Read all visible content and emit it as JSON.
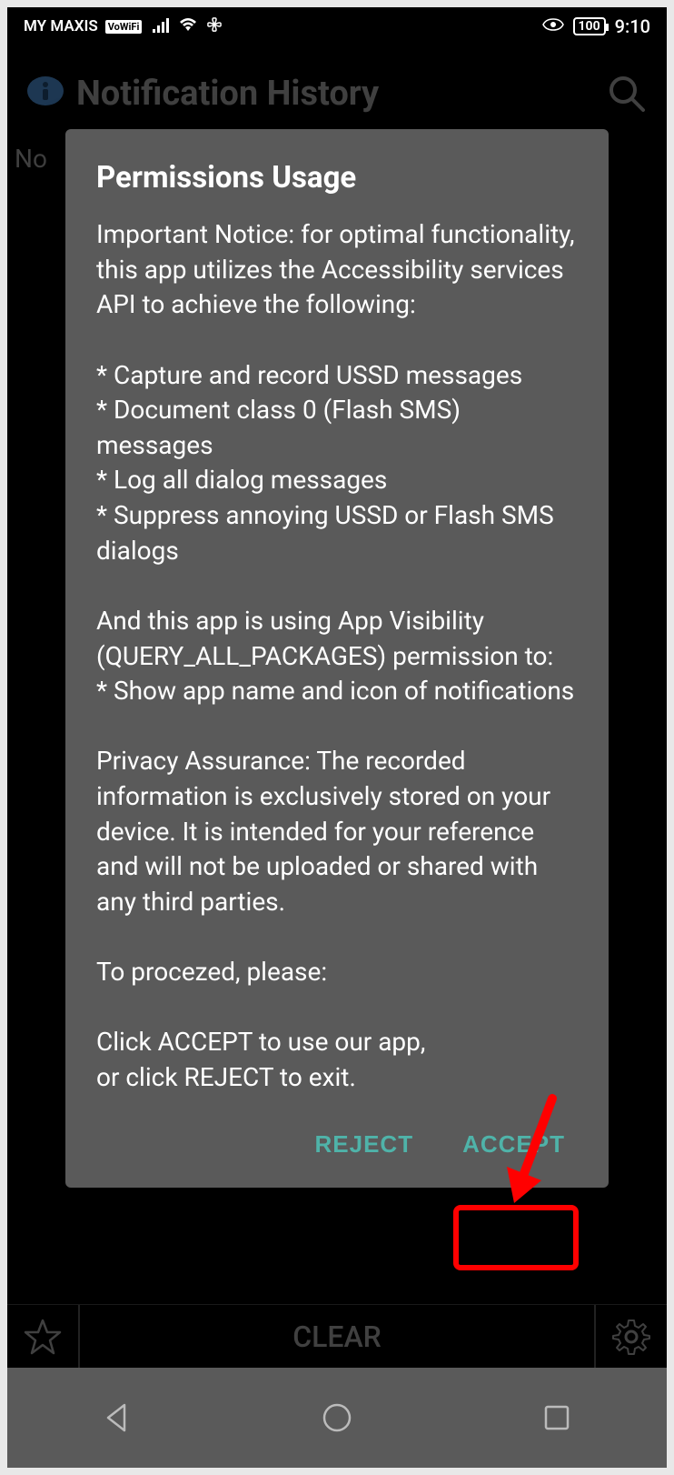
{
  "statusBar": {
    "carrier": "MY MAXIS",
    "vowifi": "VoWiFi",
    "battery": "100",
    "time": "9:10"
  },
  "appHeader": {
    "title": "Notification History"
  },
  "emptyState": "No",
  "toolbar": {
    "clear": "CLEAR"
  },
  "dialog": {
    "title": "Permissions Usage",
    "body": "Important Notice: for optimal functionality, this app utilizes the Accessibility services API to achieve the following:\n\n* Capture and record USSD messages\n* Document class 0 (Flash SMS) messages\n* Log all dialog messages\n* Suppress annoying USSD or Flash SMS dialogs\n\nAnd this app is using App Visibility (QUERY_ALL_PACKAGES) permission to:\n* Show app name and icon of notifications\n\nPrivacy Assurance: The recorded information is exclusively stored on your device. It is intended for your reference and will not be uploaded or shared with any third parties.\n\nTo procezed, please:\n\nClick ACCEPT to use our app,\nor click REJECT to exit.",
    "reject": "REJECT",
    "accept": "ACCEPT"
  }
}
